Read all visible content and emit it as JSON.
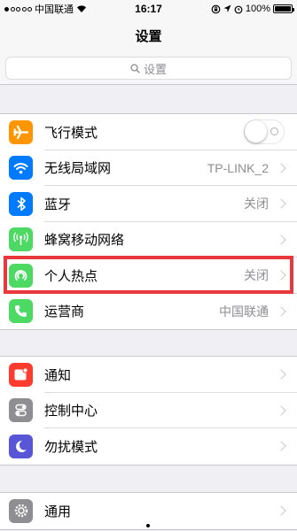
{
  "status_bar": {
    "carrier": "中国联通",
    "time": "16:17",
    "battery": "100%"
  },
  "nav": {
    "title": "设置"
  },
  "search": {
    "placeholder": "设置"
  },
  "groups": [
    {
      "items": [
        {
          "label": "飞行模式",
          "icon": "airplane-icon",
          "color": "#ff9500",
          "toggle": "off"
        },
        {
          "label": "无线局域网",
          "icon": "wifi-icon",
          "color": "#007aff",
          "value": "TP-LINK_2"
        },
        {
          "label": "蓝牙",
          "icon": "bluetooth-icon",
          "color": "#007aff",
          "value": "关闭"
        },
        {
          "label": "蜂窝移动网络",
          "icon": "cellular-icon",
          "color": "#4cd964"
        },
        {
          "label": "个人热点",
          "icon": "hotspot-icon",
          "color": "#4cd964",
          "value": "关闭"
        },
        {
          "label": "运营商",
          "icon": "phone-icon",
          "color": "#4cd964",
          "value": "中国联通"
        }
      ]
    },
    {
      "items": [
        {
          "label": "通知",
          "icon": "notifications-icon",
          "color": "#ff3b30"
        },
        {
          "label": "控制中心",
          "icon": "control-center-icon",
          "color": "#8e8e93"
        },
        {
          "label": "勿扰模式",
          "icon": "moon-icon",
          "color": "#5856d6"
        }
      ]
    },
    {
      "items": [
        {
          "label": "通用",
          "icon": "gear-icon",
          "color": "#8e8e93"
        }
      ]
    }
  ],
  "highlight_color": "#e8383d"
}
